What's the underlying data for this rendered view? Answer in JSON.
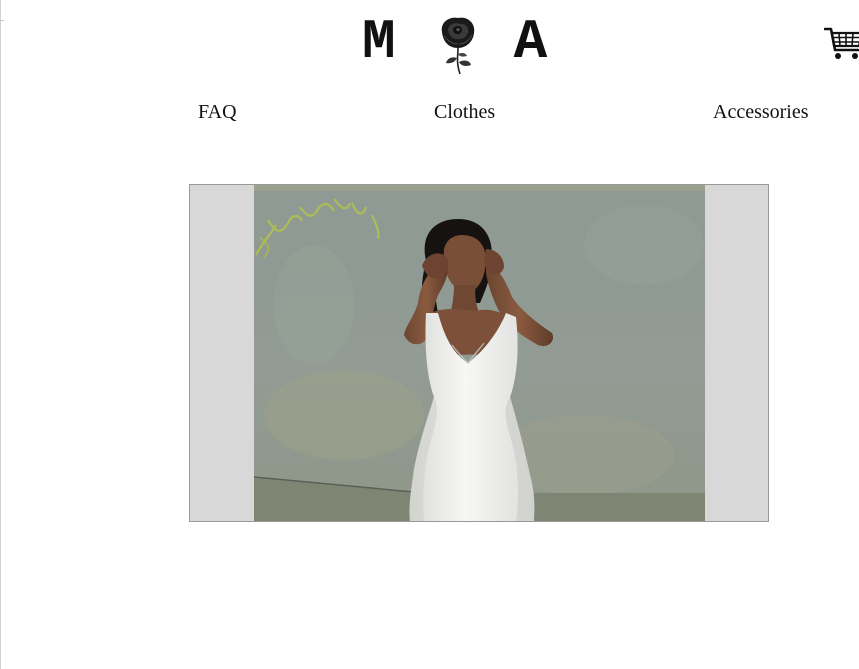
{
  "brand": {
    "letter_left": "M",
    "letter_right": "A",
    "logo_icon": "rose-icon"
  },
  "header": {
    "cart_icon": "shopping-cart-icon"
  },
  "nav": {
    "items": [
      {
        "label": "FAQ"
      },
      {
        "label": "Clothes"
      },
      {
        "label": "Accessories"
      }
    ]
  },
  "slideshow": {
    "frame_color": "#d8d8d8",
    "border_color": "#9a9a9a"
  },
  "colors": {
    "background": "#ffffff",
    "text": "#111111"
  }
}
